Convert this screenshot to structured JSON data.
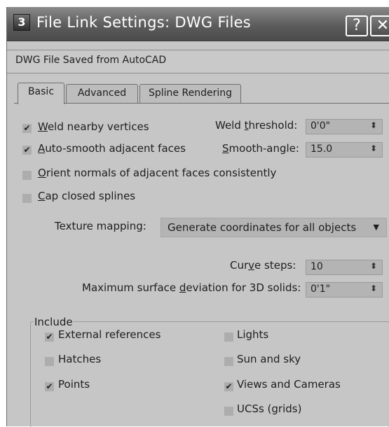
{
  "dialog": {
    "title": "File Link Settings: DWG Files",
    "icon_glyph": "3",
    "help_glyph": "?",
    "close_glyph": "✕"
  },
  "source": "DWG File Saved from AutoCAD",
  "tabs": [
    {
      "label": "Basic",
      "active": true
    },
    {
      "label": "Advanced",
      "active": false
    },
    {
      "label": "Spline Rendering",
      "active": false
    }
  ],
  "basic": {
    "weld_vertices": {
      "pre": "",
      "key": "W",
      "post": "eld nearby vertices",
      "checked": true
    },
    "auto_smooth": {
      "pre": "",
      "key": "A",
      "post": "uto-smooth adjacent faces",
      "checked": true
    },
    "orient_normals": {
      "pre": "",
      "key": "O",
      "post": "rient normals of adjacent faces consistently",
      "checked": false
    },
    "cap_splines": {
      "pre": "",
      "key": "C",
      "post": "ap closed splines",
      "checked": false
    },
    "weld_threshold": {
      "pre": "Weld ",
      "key": "t",
      "post": "hreshold:",
      "value": "0'0\""
    },
    "smooth_angle": {
      "pre": "",
      "key": "S",
      "post": "mooth-angle:",
      "value": "15.0"
    },
    "texture_mapping": {
      "label": "Texture mapping:",
      "value": "Generate coordinates for all objects"
    },
    "curve_steps": {
      "pre": "Cur",
      "key": "v",
      "post": "e steps:",
      "value": "10"
    },
    "max_deviation": {
      "pre": "Maximum surface ",
      "key": "d",
      "post": "eviation for 3D solids:",
      "value": "0'1\""
    },
    "spinner_arrow": "⬍",
    "dropdown_arrow": "▼"
  },
  "include": {
    "title": "Include",
    "items": [
      {
        "label": "External references",
        "checked": true
      },
      {
        "label": "Hatches",
        "checked": false
      },
      {
        "label": "Points",
        "checked": true
      },
      {
        "label": "Lights",
        "checked": false
      },
      {
        "label": "Sun and sky",
        "checked": false
      },
      {
        "label": "Views and Cameras",
        "checked": true
      },
      {
        "label": "UCSs (grids)",
        "checked": false
      }
    ]
  },
  "colors": {
    "dialog_bg": "#c6c6c6",
    "titlebar": "#5c5c5c",
    "field_bg": "#b4b4b4"
  }
}
